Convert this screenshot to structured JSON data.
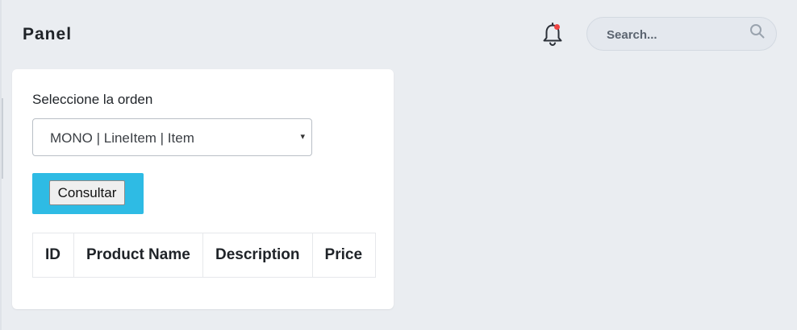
{
  "header": {
    "title": "Panel",
    "notification_icon": "bell-icon",
    "notification_dot_color": "#ef4444",
    "search": {
      "placeholder": "Search...",
      "icon": "search-icon"
    }
  },
  "form": {
    "label": "Seleccione la orden",
    "select": {
      "selected": "MONO | LineItem | Item",
      "caret": "▾"
    },
    "submit_label": "Consultar",
    "accent_color": "#2ebbe4"
  },
  "table": {
    "columns": [
      "ID",
      "Product Name",
      "Description",
      "Price"
    ],
    "rows": []
  }
}
